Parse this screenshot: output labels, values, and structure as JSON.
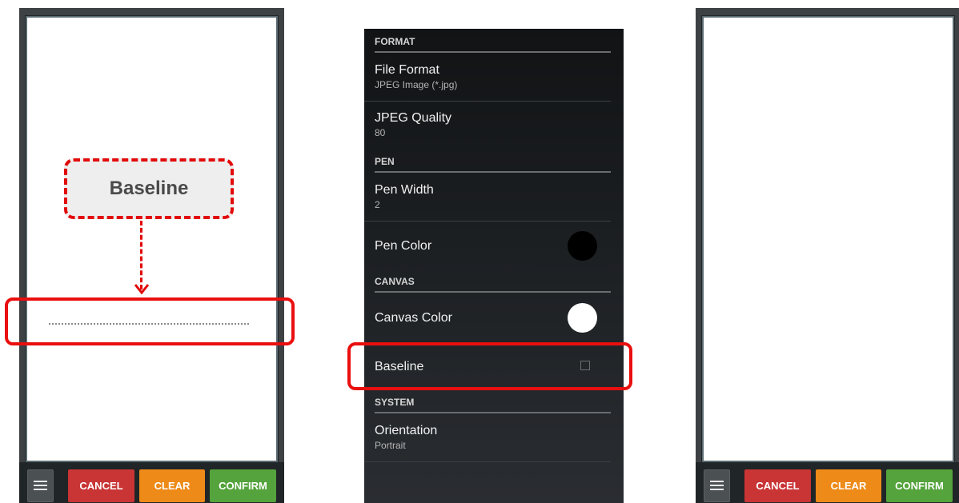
{
  "left_panel": {
    "callout_label": "Baseline",
    "toolbar": {
      "cancel": "CANCEL",
      "clear": "CLEAR",
      "confirm": "CONFIRM"
    }
  },
  "settings": {
    "sections": {
      "format": "FORMAT",
      "pen": "PEN",
      "canvas": "CANVAS",
      "system": "SYSTEM"
    },
    "file_format": {
      "title": "File Format",
      "value": "JPEG Image (*.jpg)"
    },
    "jpeg_quality": {
      "title": "JPEG Quality",
      "value": "80"
    },
    "pen_width": {
      "title": "Pen Width",
      "value": "2"
    },
    "pen_color": {
      "title": "Pen Color",
      "color": "#000000"
    },
    "canvas_color": {
      "title": "Canvas Color",
      "color": "#ffffff"
    },
    "baseline": {
      "title": "Baseline",
      "checked": false
    },
    "orientation": {
      "title": "Orientation",
      "value": "Portrait"
    }
  },
  "right_panel": {
    "toolbar": {
      "cancel": "CANCEL",
      "clear": "CLEAR",
      "confirm": "CONFIRM"
    }
  },
  "colors": {
    "highlight": "#ea0f0f",
    "cancel": "#c93435",
    "clear": "#ee8a18",
    "confirm": "#54a33c"
  }
}
